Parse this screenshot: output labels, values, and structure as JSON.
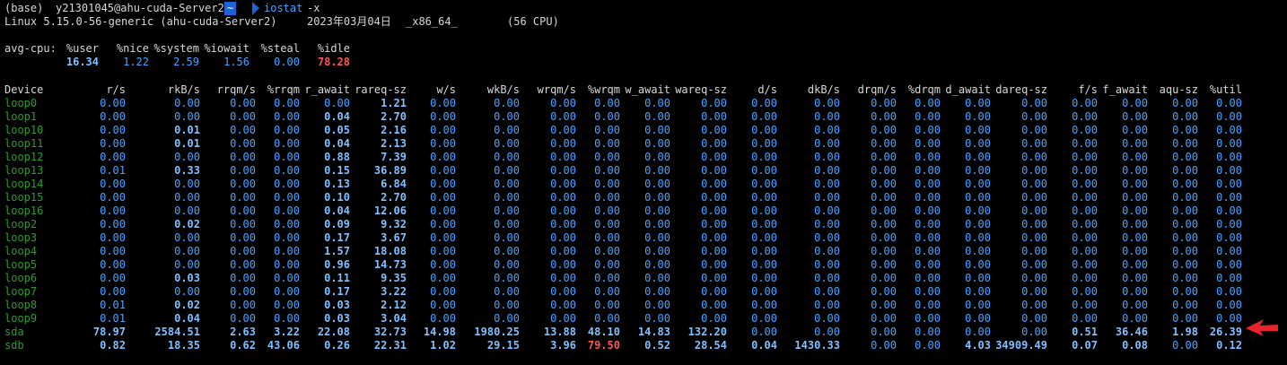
{
  "prompt": {
    "env": "(base)",
    "user_host": "y21301045@ahu-cuda-Server2",
    "dir": "~",
    "command": "iostat",
    "args": "-x"
  },
  "sysinfo": {
    "kernel": "Linux 5.15.0-56-generic (ahu-cuda-Server2)",
    "date": "2023年03月04日",
    "arch": "_x86_64_",
    "cpus": "(56 CPU)"
  },
  "cpu": {
    "label": "avg-cpu:",
    "headers": [
      "%user",
      "%nice",
      "%system",
      "%iowait",
      "%steal",
      "%idle"
    ],
    "values": [
      "16.34",
      "1.22",
      "2.59",
      "1.56",
      "0.00",
      "78.28"
    ]
  },
  "table": {
    "headers": [
      "Device",
      "r/s",
      "rkB/s",
      "rrqm/s",
      "%rrqm",
      "r_await",
      "rareq-sz",
      "w/s",
      "wkB/s",
      "wrqm/s",
      "%wrqm",
      "w_await",
      "wareq-sz",
      "d/s",
      "dkB/s",
      "drqm/s",
      "%drqm",
      "d_await",
      "dareq-sz",
      "f/s",
      "f_await",
      "aqu-sz",
      "%util"
    ],
    "rows": [
      {
        "device": "loop0",
        "values": [
          "0.00",
          "0.00",
          "0.00",
          "0.00",
          "0.00",
          "1.21",
          "0.00",
          "0.00",
          "0.00",
          "0.00",
          "0.00",
          "0.00",
          "0.00",
          "0.00",
          "0.00",
          "0.00",
          "0.00",
          "0.00",
          "0.00",
          "0.00",
          "0.00",
          "0.00"
        ]
      },
      {
        "device": "loop1",
        "values": [
          "0.00",
          "0.00",
          "0.00",
          "0.00",
          "0.04",
          "2.70",
          "0.00",
          "0.00",
          "0.00",
          "0.00",
          "0.00",
          "0.00",
          "0.00",
          "0.00",
          "0.00",
          "0.00",
          "0.00",
          "0.00",
          "0.00",
          "0.00",
          "0.00",
          "0.00"
        ]
      },
      {
        "device": "loop10",
        "values": [
          "0.00",
          "0.01",
          "0.00",
          "0.00",
          "0.05",
          "2.16",
          "0.00",
          "0.00",
          "0.00",
          "0.00",
          "0.00",
          "0.00",
          "0.00",
          "0.00",
          "0.00",
          "0.00",
          "0.00",
          "0.00",
          "0.00",
          "0.00",
          "0.00",
          "0.00"
        ]
      },
      {
        "device": "loop11",
        "values": [
          "0.00",
          "0.01",
          "0.00",
          "0.00",
          "0.04",
          "2.13",
          "0.00",
          "0.00",
          "0.00",
          "0.00",
          "0.00",
          "0.00",
          "0.00",
          "0.00",
          "0.00",
          "0.00",
          "0.00",
          "0.00",
          "0.00",
          "0.00",
          "0.00",
          "0.00"
        ]
      },
      {
        "device": "loop12",
        "values": [
          "0.00",
          "0.00",
          "0.00",
          "0.00",
          "0.88",
          "7.39",
          "0.00",
          "0.00",
          "0.00",
          "0.00",
          "0.00",
          "0.00",
          "0.00",
          "0.00",
          "0.00",
          "0.00",
          "0.00",
          "0.00",
          "0.00",
          "0.00",
          "0.00",
          "0.00"
        ]
      },
      {
        "device": "loop13",
        "values": [
          "0.01",
          "0.33",
          "0.00",
          "0.00",
          "0.15",
          "36.89",
          "0.00",
          "0.00",
          "0.00",
          "0.00",
          "0.00",
          "0.00",
          "0.00",
          "0.00",
          "0.00",
          "0.00",
          "0.00",
          "0.00",
          "0.00",
          "0.00",
          "0.00",
          "0.00"
        ]
      },
      {
        "device": "loop14",
        "values": [
          "0.00",
          "0.00",
          "0.00",
          "0.00",
          "0.13",
          "6.84",
          "0.00",
          "0.00",
          "0.00",
          "0.00",
          "0.00",
          "0.00",
          "0.00",
          "0.00",
          "0.00",
          "0.00",
          "0.00",
          "0.00",
          "0.00",
          "0.00",
          "0.00",
          "0.00"
        ]
      },
      {
        "device": "loop15",
        "values": [
          "0.00",
          "0.00",
          "0.00",
          "0.00",
          "0.10",
          "2.70",
          "0.00",
          "0.00",
          "0.00",
          "0.00",
          "0.00",
          "0.00",
          "0.00",
          "0.00",
          "0.00",
          "0.00",
          "0.00",
          "0.00",
          "0.00",
          "0.00",
          "0.00",
          "0.00"
        ]
      },
      {
        "device": "loop16",
        "values": [
          "0.00",
          "0.00",
          "0.00",
          "0.00",
          "0.04",
          "12.06",
          "0.00",
          "0.00",
          "0.00",
          "0.00",
          "0.00",
          "0.00",
          "0.00",
          "0.00",
          "0.00",
          "0.00",
          "0.00",
          "0.00",
          "0.00",
          "0.00",
          "0.00",
          "0.00"
        ]
      },
      {
        "device": "loop2",
        "values": [
          "0.00",
          "0.02",
          "0.00",
          "0.00",
          "0.09",
          "9.32",
          "0.00",
          "0.00",
          "0.00",
          "0.00",
          "0.00",
          "0.00",
          "0.00",
          "0.00",
          "0.00",
          "0.00",
          "0.00",
          "0.00",
          "0.00",
          "0.00",
          "0.00",
          "0.00"
        ]
      },
      {
        "device": "loop3",
        "values": [
          "0.00",
          "0.00",
          "0.00",
          "0.00",
          "0.17",
          "3.67",
          "0.00",
          "0.00",
          "0.00",
          "0.00",
          "0.00",
          "0.00",
          "0.00",
          "0.00",
          "0.00",
          "0.00",
          "0.00",
          "0.00",
          "0.00",
          "0.00",
          "0.00",
          "0.00"
        ]
      },
      {
        "device": "loop4",
        "values": [
          "0.00",
          "0.00",
          "0.00",
          "0.00",
          "1.57",
          "18.08",
          "0.00",
          "0.00",
          "0.00",
          "0.00",
          "0.00",
          "0.00",
          "0.00",
          "0.00",
          "0.00",
          "0.00",
          "0.00",
          "0.00",
          "0.00",
          "0.00",
          "0.00",
          "0.00"
        ]
      },
      {
        "device": "loop5",
        "values": [
          "0.00",
          "0.00",
          "0.00",
          "0.00",
          "0.96",
          "14.73",
          "0.00",
          "0.00",
          "0.00",
          "0.00",
          "0.00",
          "0.00",
          "0.00",
          "0.00",
          "0.00",
          "0.00",
          "0.00",
          "0.00",
          "0.00",
          "0.00",
          "0.00",
          "0.00"
        ]
      },
      {
        "device": "loop6",
        "values": [
          "0.00",
          "0.03",
          "0.00",
          "0.00",
          "0.11",
          "9.35",
          "0.00",
          "0.00",
          "0.00",
          "0.00",
          "0.00",
          "0.00",
          "0.00",
          "0.00",
          "0.00",
          "0.00",
          "0.00",
          "0.00",
          "0.00",
          "0.00",
          "0.00",
          "0.00"
        ]
      },
      {
        "device": "loop7",
        "values": [
          "0.00",
          "0.00",
          "0.00",
          "0.00",
          "0.17",
          "3.22",
          "0.00",
          "0.00",
          "0.00",
          "0.00",
          "0.00",
          "0.00",
          "0.00",
          "0.00",
          "0.00",
          "0.00",
          "0.00",
          "0.00",
          "0.00",
          "0.00",
          "0.00",
          "0.00"
        ]
      },
      {
        "device": "loop8",
        "values": [
          "0.01",
          "0.02",
          "0.00",
          "0.00",
          "0.03",
          "2.12",
          "0.00",
          "0.00",
          "0.00",
          "0.00",
          "0.00",
          "0.00",
          "0.00",
          "0.00",
          "0.00",
          "0.00",
          "0.00",
          "0.00",
          "0.00",
          "0.00",
          "0.00",
          "0.00"
        ]
      },
      {
        "device": "loop9",
        "values": [
          "0.01",
          "0.04",
          "0.00",
          "0.00",
          "0.03",
          "3.04",
          "0.00",
          "0.00",
          "0.00",
          "0.00",
          "0.00",
          "0.00",
          "0.00",
          "0.00",
          "0.00",
          "0.00",
          "0.00",
          "0.00",
          "0.00",
          "0.00",
          "0.00",
          "0.00"
        ]
      },
      {
        "device": "sda",
        "values": [
          "78.97",
          "2584.51",
          "2.63",
          "3.22",
          "22.08",
          "32.73",
          "14.98",
          "1980.25",
          "13.88",
          "48.10",
          "14.83",
          "132.20",
          "0.00",
          "0.00",
          "0.00",
          "0.00",
          "0.00",
          "0.00",
          "0.51",
          "36.46",
          "1.98",
          "26.39"
        ]
      },
      {
        "device": "sdb",
        "values": [
          "0.82",
          "18.35",
          "0.62",
          "43.06",
          "0.26",
          "22.31",
          "1.02",
          "29.15",
          "3.96",
          "79.50",
          "0.52",
          "28.54",
          "0.04",
          "1430.33",
          "0.00",
          "0.00",
          "4.03",
          "34909.49",
          "0.07",
          "0.08",
          "0.00",
          "0.12"
        ]
      }
    ]
  },
  "annotation": {
    "icon": "red-arrow-icon",
    "target_row": "sda",
    "color": "#e8232a"
  },
  "colors": {
    "background": "#000000",
    "text": "#d8d8d8",
    "value": "#4aa3ff",
    "bold_value": "#7fc0ff",
    "highlight": "#ff5555",
    "device": "#2e9b2e",
    "prompt_dir_bg": "#1e63d6"
  }
}
